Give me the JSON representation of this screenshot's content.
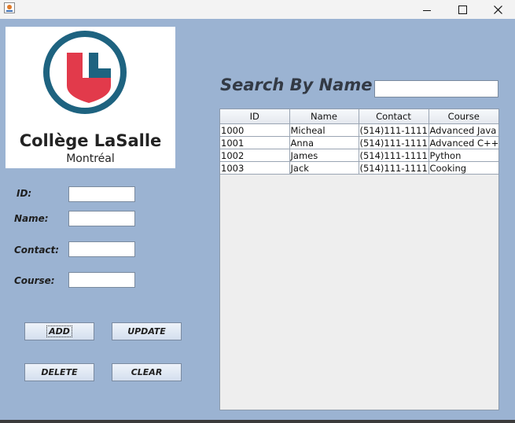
{
  "window": {
    "icon": "java-coffee-icon",
    "controls": {
      "minimize": "minimize-icon",
      "maximize": "maximize-icon",
      "close": "close-icon"
    }
  },
  "logo": {
    "name": "Collège LaSalle",
    "city": "Montréal",
    "colors": {
      "ring": "#1e6380",
      "shield": "#e23a4b"
    }
  },
  "form": {
    "id_label": "ID:",
    "name_label": "Name:",
    "contact_label": "Contact:",
    "course_label": "Course:",
    "id_value": "",
    "name_value": "",
    "contact_value": "",
    "course_value": ""
  },
  "buttons": {
    "add": "ADD",
    "update": "UPDATE",
    "delete": "DELETE",
    "clear": "CLEAR"
  },
  "search": {
    "title": "Search By Name",
    "value": ""
  },
  "table": {
    "columns": [
      "ID",
      "Name",
      "Contact",
      "Course"
    ],
    "rows": [
      [
        "1000",
        "Micheal",
        "(514)111-1111",
        "Advanced Java"
      ],
      [
        "1001",
        "Anna",
        "(514)111-1111",
        "Advanced C++"
      ],
      [
        "1002",
        "James",
        "(514)111-1111",
        "Python"
      ],
      [
        "1003",
        "Jack",
        "(514)111-1111",
        "Cooking"
      ]
    ]
  },
  "colors": {
    "background": "#9bb3d2",
    "title_bar": "#f3f3f3"
  }
}
